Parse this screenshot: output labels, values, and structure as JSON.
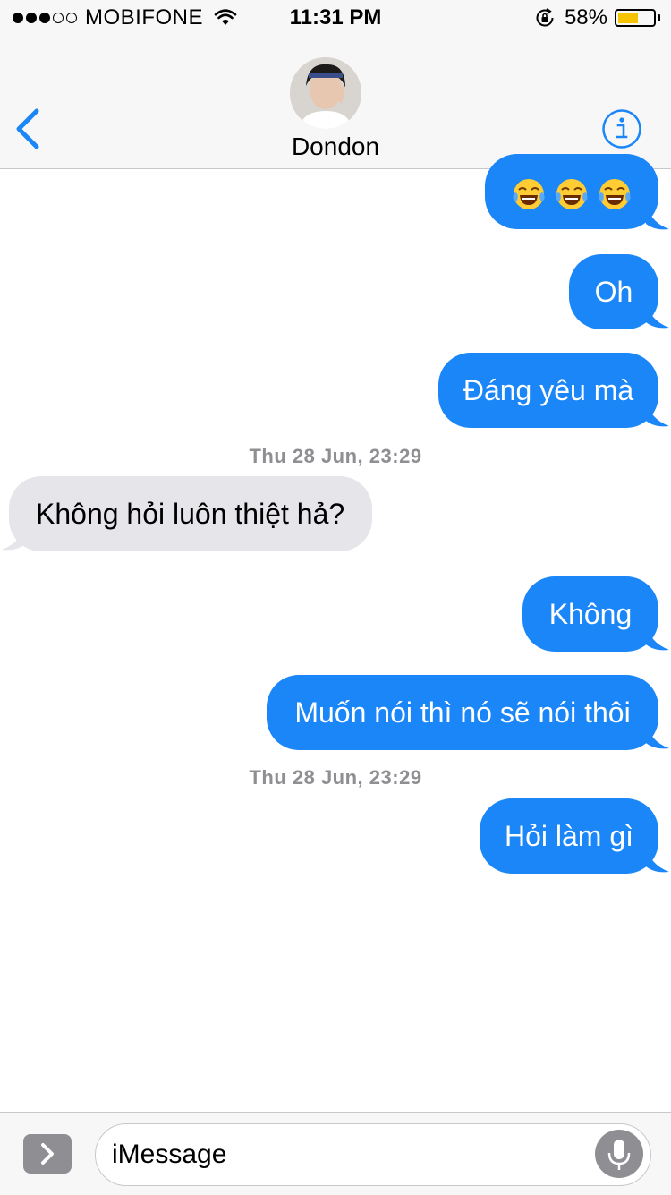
{
  "status_bar": {
    "carrier": "MOBIFONE",
    "signal_bars_filled": 3,
    "signal_bars_total": 5,
    "time": "11:31 PM",
    "battery_percent": "58%",
    "battery_level": 0.58
  },
  "header": {
    "contact_name": "Dondon",
    "back_icon": "chevron-left-icon",
    "info_icon": "info-icon"
  },
  "messages": [
    {
      "type": "out",
      "emoji": [
        "face-with-tears-of-joy",
        "face-with-tears-of-joy",
        "face-with-tears-of-joy"
      ]
    },
    {
      "type": "out",
      "text": "Oh"
    },
    {
      "type": "out",
      "text": "Đáng yêu mà"
    },
    {
      "type": "timestamp",
      "text": "Thu 28 Jun, 23:29"
    },
    {
      "type": "in",
      "text": "Không hỏi luôn thiệt hả?"
    },
    {
      "type": "out",
      "text": "Không"
    },
    {
      "type": "out",
      "text": "Muốn nói thì nó sẽ nói thôi"
    },
    {
      "type": "timestamp",
      "text": "Thu 28 Jun, 23:29"
    },
    {
      "type": "out",
      "text": "Hỏi làm gì"
    }
  ],
  "composer": {
    "placeholder": "iMessage",
    "apps_icon": "chevron-right-icon",
    "mic_icon": "microphone-icon"
  },
  "colors": {
    "outgoing_bubble": "#1b86f8",
    "incoming_bubble": "#e5e5ea",
    "accent": "#1b86f8",
    "timestamp": "#8e8e93"
  }
}
